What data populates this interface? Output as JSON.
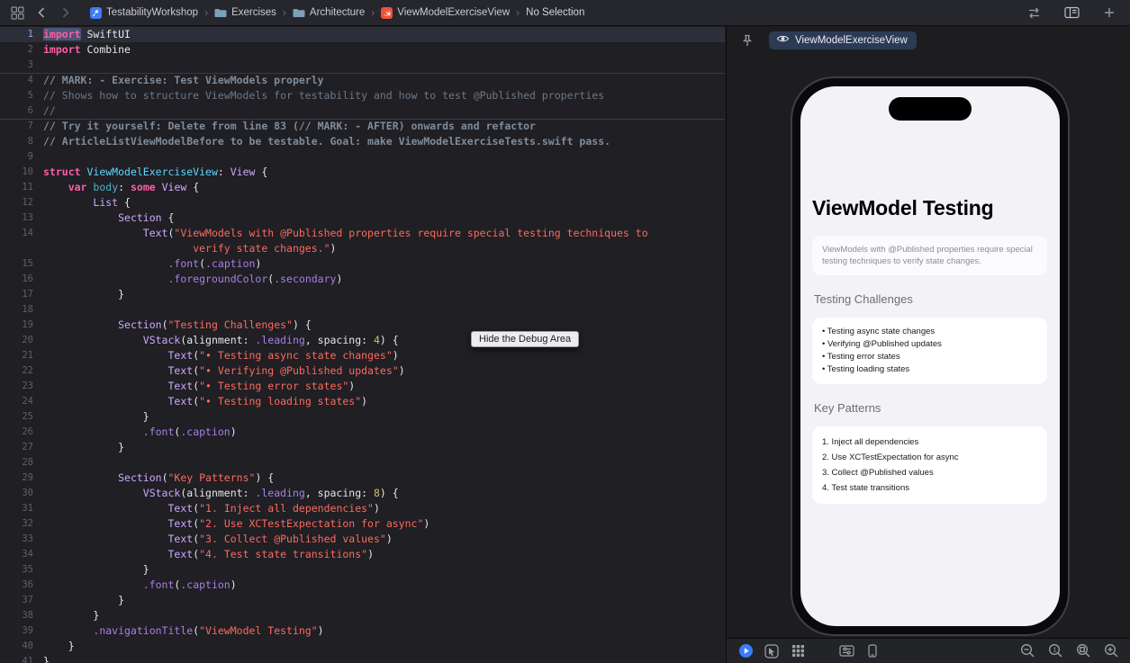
{
  "toolbar": {
    "breadcrumbs": [
      {
        "label": "TestabilityWorkshop",
        "icon": "app"
      },
      {
        "label": "Exercises",
        "icon": "folder"
      },
      {
        "label": "Architecture",
        "icon": "folder"
      },
      {
        "label": "ViewModelExerciseView",
        "icon": "swift"
      },
      {
        "label": "No Selection",
        "icon": "none"
      }
    ]
  },
  "tooltip": {
    "text": "Hide the Debug Area"
  },
  "editor": {
    "rows": [
      {
        "n": "1",
        "cur": 1,
        "t": [
          [
            "kw hl",
            "import"
          ],
          [
            "pl",
            " SwiftUI"
          ]
        ]
      },
      {
        "n": "2",
        "t": [
          [
            "kw",
            "import"
          ],
          [
            "pl",
            " Combine"
          ]
        ]
      },
      {
        "n": "3",
        "t": []
      },
      {
        "n": "4",
        "d": 1,
        "t": [
          [
            "cmb",
            "// MARK: - Exercise: Test ViewModels properly"
          ]
        ]
      },
      {
        "n": "5",
        "t": [
          [
            "cm",
            "// Shows how to structure ViewModels for testability and how to test @Published properties"
          ]
        ]
      },
      {
        "n": "6",
        "t": [
          [
            "cm",
            "//"
          ]
        ]
      },
      {
        "n": "7",
        "d": 1,
        "t": [
          [
            "cmb",
            "// Try it yourself: Delete from line 83 (// MARK: - AFTER) onwards and refactor"
          ]
        ]
      },
      {
        "n": "8",
        "t": [
          [
            "cmb",
            "// ArticleListViewModelBefore to be testable. Goal: make ViewModelExerciseTests.swift pass."
          ]
        ]
      },
      {
        "n": "9",
        "t": []
      },
      {
        "n": "10",
        "t": [
          [
            "kw",
            "struct"
          ],
          [
            "pl",
            " "
          ],
          [
            "tdc",
            "ViewModelExerciseView"
          ],
          [
            "pl",
            ": "
          ],
          [
            "typ",
            "View"
          ],
          [
            "pl",
            " {"
          ]
        ]
      },
      {
        "n": "11",
        "t": [
          [
            "pl",
            "    "
          ],
          [
            "kw",
            "var"
          ],
          [
            "pl",
            " "
          ],
          [
            "dcl",
            "body"
          ],
          [
            "pl",
            ": "
          ],
          [
            "kw",
            "some"
          ],
          [
            "pl",
            " "
          ],
          [
            "typ",
            "View"
          ],
          [
            "pl",
            " {"
          ]
        ]
      },
      {
        "n": "12",
        "t": [
          [
            "pl",
            "        "
          ],
          [
            "typ",
            "List"
          ],
          [
            "pl",
            " {"
          ]
        ]
      },
      {
        "n": "13",
        "t": [
          [
            "pl",
            "            "
          ],
          [
            "typ",
            "Section"
          ],
          [
            "pl",
            " {"
          ]
        ]
      },
      {
        "n": "14",
        "t": [
          [
            "pl",
            "                "
          ],
          [
            "typ",
            "Text"
          ],
          [
            "pl",
            "("
          ],
          [
            "str",
            "\"ViewModels with @Published properties require special testing techniques to"
          ]
        ]
      },
      {
        "n": "",
        "t": [
          [
            "pl",
            "                        "
          ],
          [
            "str",
            "verify state changes.\""
          ],
          [
            "pl",
            ")"
          ]
        ]
      },
      {
        "n": "15",
        "t": [
          [
            "pl",
            "                    "
          ],
          [
            "mem",
            ".font"
          ],
          [
            "pl",
            "("
          ],
          [
            "mem",
            ".caption"
          ],
          [
            "pl",
            ")"
          ]
        ]
      },
      {
        "n": "16",
        "t": [
          [
            "pl",
            "                    "
          ],
          [
            "mem",
            ".foregroundColor"
          ],
          [
            "pl",
            "("
          ],
          [
            "mem",
            ".secondary"
          ],
          [
            "pl",
            ")"
          ]
        ]
      },
      {
        "n": "17",
        "t": [
          [
            "pl",
            "            }"
          ]
        ]
      },
      {
        "n": "18",
        "t": []
      },
      {
        "n": "19",
        "t": [
          [
            "pl",
            "            "
          ],
          [
            "typ",
            "Section"
          ],
          [
            "pl",
            "("
          ],
          [
            "str",
            "\"Testing Challenges\""
          ],
          [
            "pl",
            ") {"
          ]
        ]
      },
      {
        "n": "20",
        "t": [
          [
            "pl",
            "                "
          ],
          [
            "typ",
            "VStack"
          ],
          [
            "pl",
            "(alignment: "
          ],
          [
            "mem",
            ".leading"
          ],
          [
            "pl",
            ", spacing: "
          ],
          [
            "num",
            "4"
          ],
          [
            "pl",
            ") {"
          ]
        ]
      },
      {
        "n": "21",
        "t": [
          [
            "pl",
            "                    "
          ],
          [
            "typ",
            "Text"
          ],
          [
            "pl",
            "("
          ],
          [
            "str",
            "\"• Testing async state changes\""
          ],
          [
            "pl",
            ")"
          ]
        ]
      },
      {
        "n": "22",
        "t": [
          [
            "pl",
            "                    "
          ],
          [
            "typ",
            "Text"
          ],
          [
            "pl",
            "("
          ],
          [
            "str",
            "\"• Verifying @Published updates\""
          ],
          [
            "pl",
            ")"
          ]
        ]
      },
      {
        "n": "23",
        "t": [
          [
            "pl",
            "                    "
          ],
          [
            "typ",
            "Text"
          ],
          [
            "pl",
            "("
          ],
          [
            "str",
            "\"• Testing error states\""
          ],
          [
            "pl",
            ")"
          ]
        ]
      },
      {
        "n": "24",
        "t": [
          [
            "pl",
            "                    "
          ],
          [
            "typ",
            "Text"
          ],
          [
            "pl",
            "("
          ],
          [
            "str",
            "\"• Testing loading states\""
          ],
          [
            "pl",
            ")"
          ]
        ]
      },
      {
        "n": "25",
        "t": [
          [
            "pl",
            "                }"
          ]
        ]
      },
      {
        "n": "26",
        "t": [
          [
            "pl",
            "                "
          ],
          [
            "mem",
            ".font"
          ],
          [
            "pl",
            "("
          ],
          [
            "mem",
            ".caption"
          ],
          [
            "pl",
            ")"
          ]
        ]
      },
      {
        "n": "27",
        "t": [
          [
            "pl",
            "            }"
          ]
        ]
      },
      {
        "n": "28",
        "t": []
      },
      {
        "n": "29",
        "t": [
          [
            "pl",
            "            "
          ],
          [
            "typ",
            "Section"
          ],
          [
            "pl",
            "("
          ],
          [
            "str",
            "\"Key Patterns\""
          ],
          [
            "pl",
            ") {"
          ]
        ]
      },
      {
        "n": "30",
        "t": [
          [
            "pl",
            "                "
          ],
          [
            "typ",
            "VStack"
          ],
          [
            "pl",
            "(alignment: "
          ],
          [
            "mem",
            ".leading"
          ],
          [
            "pl",
            ", spacing: "
          ],
          [
            "num",
            "8"
          ],
          [
            "pl",
            ") {"
          ]
        ]
      },
      {
        "n": "31",
        "t": [
          [
            "pl",
            "                    "
          ],
          [
            "typ",
            "Text"
          ],
          [
            "pl",
            "("
          ],
          [
            "str",
            "\"1. Inject all dependencies\""
          ],
          [
            "pl",
            ")"
          ]
        ]
      },
      {
        "n": "32",
        "t": [
          [
            "pl",
            "                    "
          ],
          [
            "typ",
            "Text"
          ],
          [
            "pl",
            "("
          ],
          [
            "str",
            "\"2. Use XCTestExpectation for async\""
          ],
          [
            "pl",
            ")"
          ]
        ]
      },
      {
        "n": "33",
        "t": [
          [
            "pl",
            "                    "
          ],
          [
            "typ",
            "Text"
          ],
          [
            "pl",
            "("
          ],
          [
            "str",
            "\"3. Collect @Published values\""
          ],
          [
            "pl",
            ")"
          ]
        ]
      },
      {
        "n": "34",
        "t": [
          [
            "pl",
            "                    "
          ],
          [
            "typ",
            "Text"
          ],
          [
            "pl",
            "("
          ],
          [
            "str",
            "\"4. Test state transitions\""
          ],
          [
            "pl",
            ")"
          ]
        ]
      },
      {
        "n": "35",
        "t": [
          [
            "pl",
            "                }"
          ]
        ]
      },
      {
        "n": "36",
        "t": [
          [
            "pl",
            "                "
          ],
          [
            "mem",
            ".font"
          ],
          [
            "pl",
            "("
          ],
          [
            "mem",
            ".caption"
          ],
          [
            "pl",
            ")"
          ]
        ]
      },
      {
        "n": "37",
        "t": [
          [
            "pl",
            "            }"
          ]
        ]
      },
      {
        "n": "38",
        "t": [
          [
            "pl",
            "        }"
          ]
        ]
      },
      {
        "n": "39",
        "t": [
          [
            "pl",
            "        "
          ],
          [
            "mem",
            ".navigationTitle"
          ],
          [
            "pl",
            "("
          ],
          [
            "str",
            "\"ViewModel Testing\""
          ],
          [
            "pl",
            ")"
          ]
        ]
      },
      {
        "n": "40",
        "t": [
          [
            "pl",
            "    }"
          ]
        ]
      },
      {
        "n": "41",
        "t": [
          [
            "pl",
            "}"
          ]
        ]
      }
    ]
  },
  "canvas": {
    "tab_label": "ViewModelExerciseView",
    "preview": {
      "nav_title": "ViewModel Testing",
      "description": "ViewModels with @Published properties require special testing techniques to verify state changes.",
      "sections": [
        {
          "header": "Testing Challenges",
          "row_gap": 4,
          "items": [
            "• Testing async state changes",
            "• Verifying @Published updates",
            "• Testing error states",
            "• Testing loading states"
          ]
        },
        {
          "header": "Key Patterns",
          "row_gap": 8,
          "items": [
            "1. Inject all dependencies",
            "2. Use XCTestExpectation for async",
            "3. Collect @Published values",
            "4. Test state transitions"
          ]
        }
      ]
    },
    "colors": {
      "accent": "#3d7bfd",
      "screen_bg": "#f2f2f7",
      "frame": "#0a0a0c"
    }
  }
}
